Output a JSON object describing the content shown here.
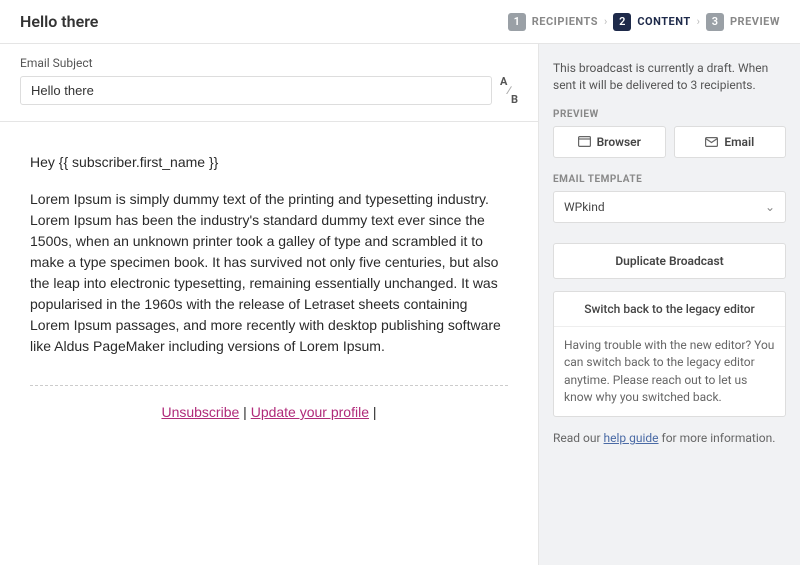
{
  "header": {
    "title": "Hello there",
    "steps": [
      {
        "num": "1",
        "label": "RECIPIENTS",
        "active": false
      },
      {
        "num": "2",
        "label": "CONTENT",
        "active": true
      },
      {
        "num": "3",
        "label": "PREVIEW",
        "active": false
      }
    ]
  },
  "subject": {
    "label": "Email Subject",
    "value": "Hello there"
  },
  "editor": {
    "greeting": "Hey {{ subscriber.first_name }}",
    "body": "Lorem Ipsum is simply dummy text of the printing and typesetting industry. Lorem Ipsum has been the industry's standard dummy text ever since the 1500s, when an unknown printer took a galley of type and scrambled it to make a type specimen book. It has survived not only five centuries, but also the leap into electronic typesetting, remaining essentially unchanged. It was popularised in the 1960s with the release of Letraset sheets containing Lorem Ipsum passages, and more recently with desktop publishing software like Aldus PageMaker including versions of Lorem Ipsum.",
    "unsubscribe": "Unsubscribe",
    "update_profile": "Update your profile"
  },
  "sidebar": {
    "draft_msg": "This broadcast is currently a draft. When sent it will be delivered to 3 recipients.",
    "preview_label": "PREVIEW",
    "browser_btn": "Browser",
    "email_btn": "Email",
    "template_label": "EMAIL TEMPLATE",
    "template_value": "WPkind",
    "duplicate_btn": "Duplicate Broadcast",
    "legacy_btn": "Switch back to the legacy editor",
    "legacy_msg": "Having trouble with the new editor? You can switch back to the legacy editor anytime. Please reach out to let us know why you switched back.",
    "help_prefix": "Read our ",
    "help_link": "help guide",
    "help_suffix": " for more information."
  }
}
